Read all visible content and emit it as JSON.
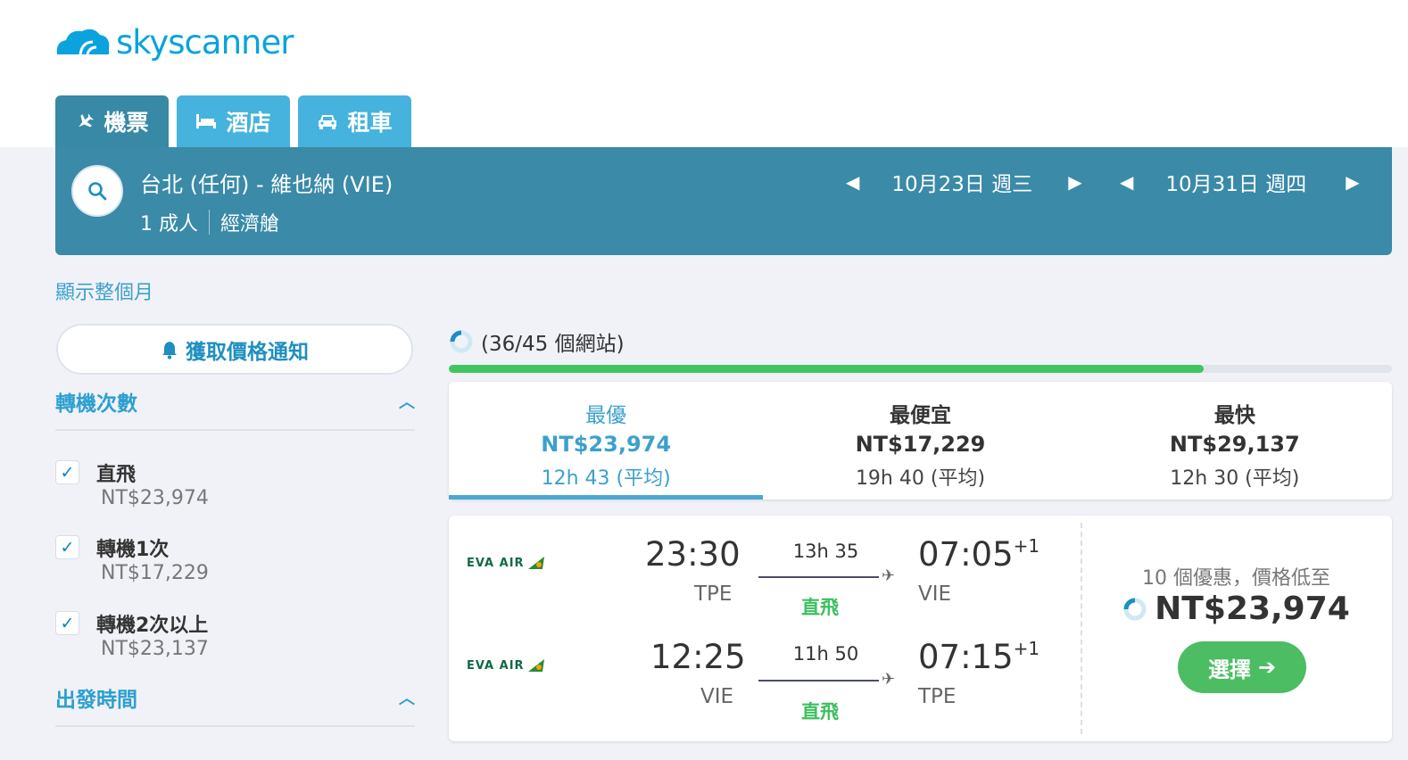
{
  "brand": {
    "name": "skyscanner"
  },
  "tabs": [
    {
      "label": "機票",
      "icon": "plane-icon"
    },
    {
      "label": "酒店",
      "icon": "bed-icon"
    },
    {
      "label": "租車",
      "icon": "car-icon"
    }
  ],
  "search": {
    "route": "台北 (任何) - 維也納 (VIE)",
    "passengers": "1 成人",
    "cabin": "經濟艙",
    "depart_date": "10月23日 週三",
    "return_date": "10月31日 週四"
  },
  "month_link": "顯示整個月",
  "price_alert": "獲取價格通知",
  "filters": {
    "stops_title": "轉機次數",
    "stops": [
      {
        "label": "直飛",
        "price": "NT$23,974"
      },
      {
        "label": "轉機1次",
        "price": "NT$17,229"
      },
      {
        "label": "轉機2次以上",
        "price": "NT$23,137"
      }
    ],
    "depart_time_title": "出發時間"
  },
  "progress": {
    "text": "(36/45 個網站)",
    "fraction": 0.8,
    "color": "#41c65f"
  },
  "sort": [
    {
      "title": "最優",
      "price": "NT$23,974",
      "duration": "12h 43 (平均)"
    },
    {
      "title": "最便宜",
      "price": "NT$17,229",
      "duration": "19h 40 (平均)"
    },
    {
      "title": "最快",
      "price": "NT$29,137",
      "duration": "12h 30 (平均)"
    }
  ],
  "result": {
    "legs": [
      {
        "airline": "EVA AIR",
        "dep_time": "23:30",
        "dep_code": "TPE",
        "duration": "13h 35",
        "stops": "直飛",
        "arr_time": "07:05",
        "arr_offset": "+1",
        "arr_code": "VIE"
      },
      {
        "airline": "EVA AIR",
        "dep_time": "12:25",
        "dep_code": "VIE",
        "duration": "11h 50",
        "stops": "直飛",
        "arr_time": "07:15",
        "arr_offset": "+1",
        "arr_code": "TPE"
      }
    ],
    "deals_text": "10 個優惠，價格低至",
    "price": "NT$23,974",
    "select_label": "選擇"
  },
  "colors": {
    "brand": "#0aa3dd",
    "searchbar": "#3a8aa8",
    "tab": "#45b3dd",
    "accent": "#3ca0cd",
    "green": "#4cbd62"
  }
}
